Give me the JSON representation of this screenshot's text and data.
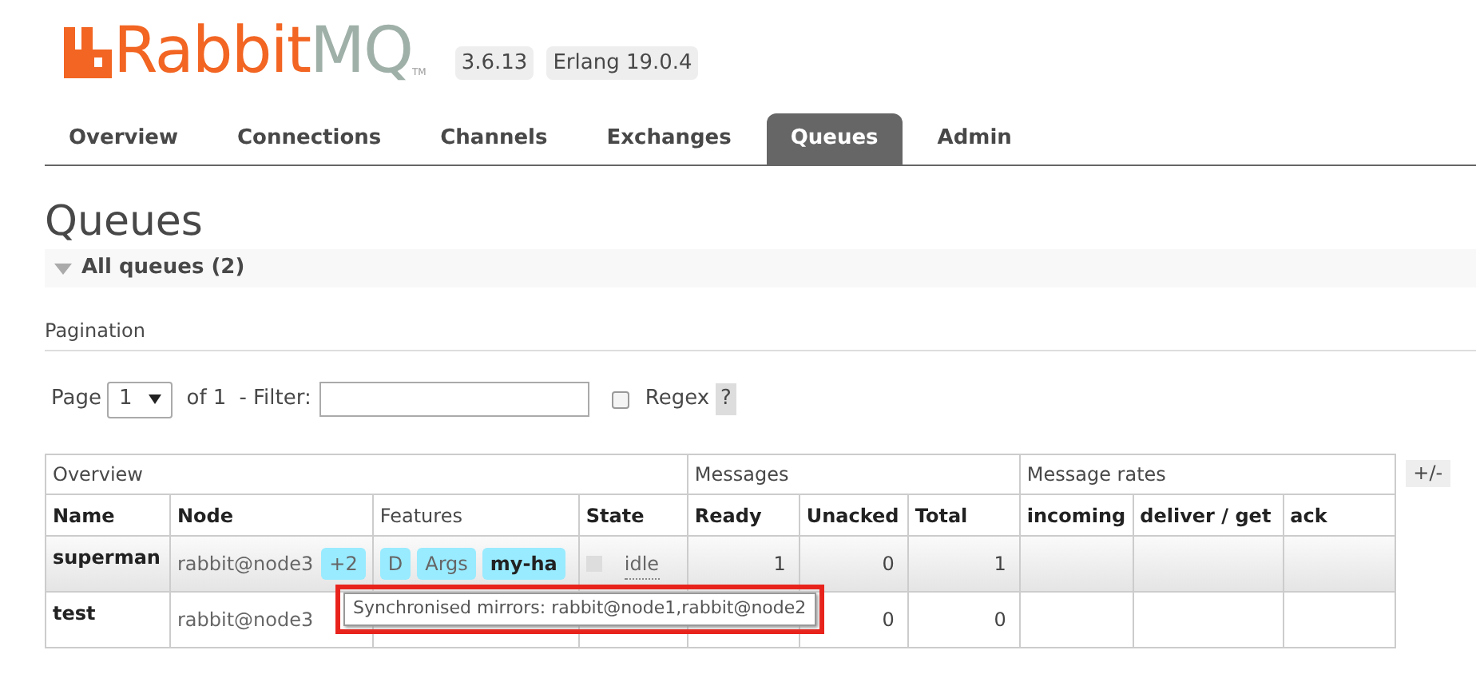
{
  "header": {
    "logo_main": "Rabbit",
    "logo_accent": "MQ",
    "logo_tm": "TM",
    "version": "3.6.13",
    "erlang": "Erlang 19.0.4"
  },
  "tabs": [
    {
      "label": "Overview",
      "selected": false
    },
    {
      "label": "Connections",
      "selected": false
    },
    {
      "label": "Channels",
      "selected": false
    },
    {
      "label": "Exchanges",
      "selected": false
    },
    {
      "label": "Queues",
      "selected": true
    },
    {
      "label": "Admin",
      "selected": false
    }
  ],
  "page_title": "Queues",
  "section": {
    "title": "All queues (2)",
    "expanded": true
  },
  "pagination": {
    "heading": "Pagination",
    "page_label": "Page",
    "page": "1",
    "of_label": "of 1",
    "filter_label": "- Filter:",
    "regex": {
      "label": "Regex",
      "checked": false
    },
    "help": "?"
  },
  "table": {
    "groups": [
      {
        "label": "Overview"
      },
      {
        "label": "Messages"
      },
      {
        "label": "Message rates"
      }
    ],
    "toggle": "+/-",
    "columns": [
      {
        "label": "Name",
        "bold": true
      },
      {
        "label": "Node",
        "bold": true
      },
      {
        "label": "Features",
        "bold": false
      },
      {
        "label": "State",
        "bold": true
      },
      {
        "label": "Ready",
        "bold": true
      },
      {
        "label": "Unacked",
        "bold": true
      },
      {
        "label": "Total",
        "bold": true
      },
      {
        "label": "incoming",
        "bold": true
      },
      {
        "label": "deliver / get",
        "bold": true
      },
      {
        "label": "ack",
        "bold": true
      }
    ],
    "rows": [
      {
        "name": "superman",
        "node": "rabbit@node3",
        "node_badge": "+2",
        "features": [
          {
            "label": "D",
            "bold": false
          },
          {
            "label": "Args",
            "bold": false
          },
          {
            "label": "my-ha",
            "bold": true
          }
        ],
        "state": "idle",
        "ready": "1",
        "unacked": "0",
        "total": "1",
        "selected": true
      },
      {
        "name": "test",
        "node": "rabbit@node3",
        "unacked": "0",
        "total": "0",
        "selected": false
      }
    ]
  },
  "tooltip": {
    "text": "Synchronised mirrors: rabbit@node1,rabbit@node2",
    "highlighted": true
  }
}
